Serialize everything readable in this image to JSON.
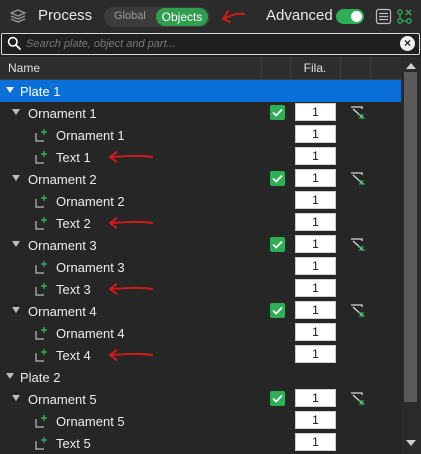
{
  "header": {
    "title": "Process",
    "toggle_global": "Global",
    "toggle_objects": "Objects",
    "advanced_label": "Advanced",
    "advanced_on": true
  },
  "search": {
    "placeholder": "Search plate, object and part..."
  },
  "columns": {
    "name": "Name",
    "filament": "Fila."
  },
  "colors": {
    "accent_green": "#2fae58",
    "selection_blue": "#0a6fd6",
    "annotation_red": "#d11c1c"
  },
  "tree": [
    {
      "label": "Plate 1",
      "level": 0,
      "type": "plate",
      "selected": true
    },
    {
      "label": "Ornament 1",
      "level": 1,
      "type": "object",
      "checked": true,
      "filament": "1",
      "support_icon": true
    },
    {
      "label": "Ornament 1",
      "level": 2,
      "type": "part",
      "filament": "1"
    },
    {
      "label": "Text 1",
      "level": 2,
      "type": "part",
      "filament": "1",
      "annotated": true
    },
    {
      "label": "Ornament 2",
      "level": 1,
      "type": "object",
      "checked": true,
      "filament": "1",
      "support_icon": true
    },
    {
      "label": "Ornament 2",
      "level": 2,
      "type": "part",
      "filament": "1"
    },
    {
      "label": "Text 2",
      "level": 2,
      "type": "part",
      "filament": "1",
      "annotated": true
    },
    {
      "label": "Ornament 3",
      "level": 1,
      "type": "object",
      "checked": true,
      "filament": "1",
      "support_icon": true
    },
    {
      "label": "Ornament 3",
      "level": 2,
      "type": "part",
      "filament": "1"
    },
    {
      "label": "Text 3",
      "level": 2,
      "type": "part",
      "filament": "1",
      "annotated": true
    },
    {
      "label": "Ornament 4",
      "level": 1,
      "type": "object",
      "checked": true,
      "filament": "1",
      "support_icon": true
    },
    {
      "label": "Ornament 4",
      "level": 2,
      "type": "part",
      "filament": "1"
    },
    {
      "label": "Text 4",
      "level": 2,
      "type": "part",
      "filament": "1",
      "annotated": true
    },
    {
      "label": "Plate 2",
      "level": 0,
      "type": "plate",
      "selected": false
    },
    {
      "label": "Ornament 5",
      "level": 1,
      "type": "object",
      "checked": true,
      "filament": "1",
      "support_icon": true
    },
    {
      "label": "Ornament 5",
      "level": 2,
      "type": "part",
      "filament": "1"
    },
    {
      "label": "Text 5",
      "level": 2,
      "type": "part",
      "filament": "1"
    }
  ]
}
